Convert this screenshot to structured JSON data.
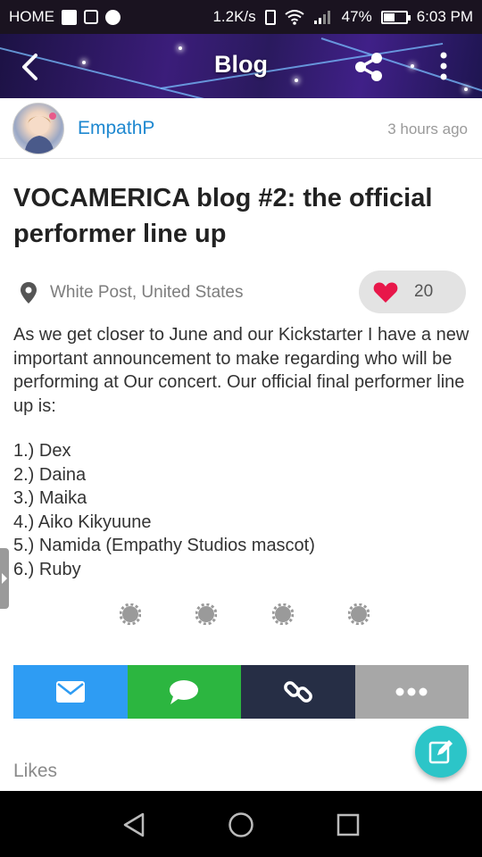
{
  "status_bar": {
    "carrier": "HOME",
    "speed": "1.2K/s",
    "battery": "47%",
    "battery_level": 0.47,
    "time": "6:03 PM",
    "icons": [
      "facebook-icon",
      "image-icon",
      "messenger-icon",
      "vibrate-icon",
      "wifi-icon",
      "signal-icon",
      "battery-icon"
    ]
  },
  "header": {
    "title": "Blog",
    "icons": [
      "back-arrow-icon",
      "share-icon",
      "more-vert-icon"
    ],
    "gradient_colors": [
      "#1c1244",
      "#3b1d7a",
      "#402088"
    ]
  },
  "author": {
    "name": "EmpathP",
    "time": "3 hours ago",
    "name_color": "#1e88d0"
  },
  "post": {
    "title": "VOCAMERICA blog #2: the official performer line up",
    "location": "White Post, United States",
    "likes": "20",
    "body": "As we get closer to June and our Kickstarter I have a new important announcement to make regarding who will be performing at Our concert. Our official final performer line up is:",
    "lineup": [
      "1.) Dex",
      "2.) Daina",
      "3.) Maika",
      "4.) Aiko Kikyuune",
      "5.) Namida (Empathy Studios mascot)",
      "6.) Ruby"
    ]
  },
  "share_bar": {
    "buttons": [
      {
        "name": "email",
        "icon": "email-icon",
        "color": "#2e9cf3"
      },
      {
        "name": "chat",
        "icon": "chat-icon",
        "color": "#2cb640"
      },
      {
        "name": "link",
        "icon": "link-icon",
        "color": "#262e45"
      },
      {
        "name": "more",
        "icon": "more-horiz-icon",
        "color": "#a7a7a7"
      }
    ]
  },
  "likes_section": {
    "heading": "Likes"
  },
  "fab": {
    "icon": "edit-icon",
    "color": "#2cc5c8"
  },
  "nav_bar": {
    "icons": [
      "nav-back-icon",
      "nav-home-icon",
      "nav-recent-icon"
    ]
  }
}
